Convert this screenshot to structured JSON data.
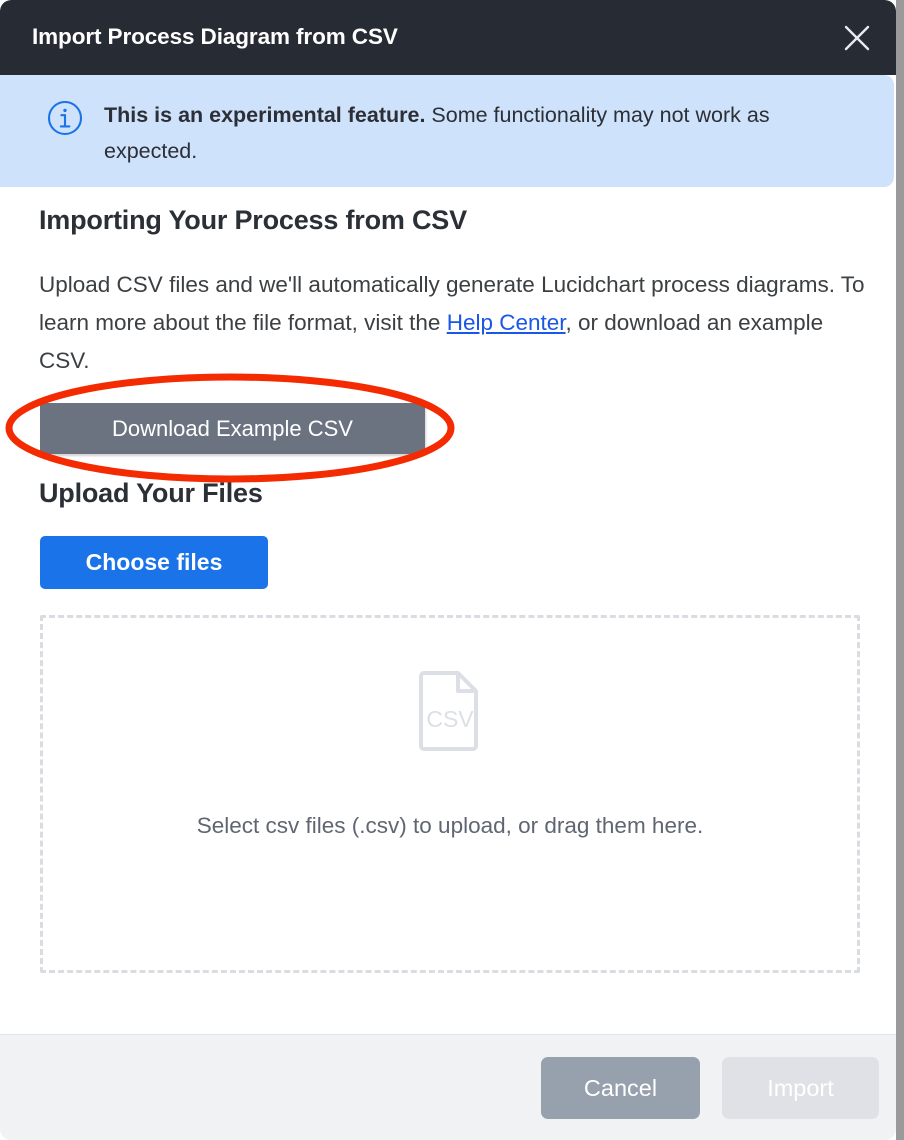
{
  "dialog": {
    "title": "Import Process Diagram from CSV",
    "close_icon": "close-icon"
  },
  "info_banner": {
    "icon": "info-circle-icon",
    "strong_text": "This is an experimental feature.",
    "rest_text": " Some functionality may not work as expected."
  },
  "import_section": {
    "heading": "Importing Your Process from CSV",
    "description_part1": "Upload CSV files and we'll automatically generate Lucidchart process diagrams. To learn more about the file format, visit the ",
    "link_label": "Help Center",
    "description_part2": ", or download an example CSV.",
    "download_button_label": "Download Example CSV"
  },
  "upload_section": {
    "heading": "Upload Your Files",
    "choose_files_label": "Choose files"
  },
  "dropzone": {
    "file_icon_label": "CSV",
    "instruction": "Select csv files (.csv) to upload, or drag them here."
  },
  "footer": {
    "cancel_label": "Cancel",
    "import_label": "Import"
  },
  "annotation": {
    "shape": "red-ellipse-highlight",
    "color": "#f42a00",
    "targets": "download-example-button"
  },
  "colors": {
    "titlebar_bg": "#272b33",
    "banner_bg": "#cfe2fb",
    "link": "#1a56e8",
    "primary_button": "#1a73e8",
    "secondary_button": "#6b7280",
    "cancel_button": "#97a0ad",
    "import_button_disabled": "#dfe1e6",
    "footer_bg": "#f1f2f4",
    "dropzone_border": "#d9dce1"
  }
}
